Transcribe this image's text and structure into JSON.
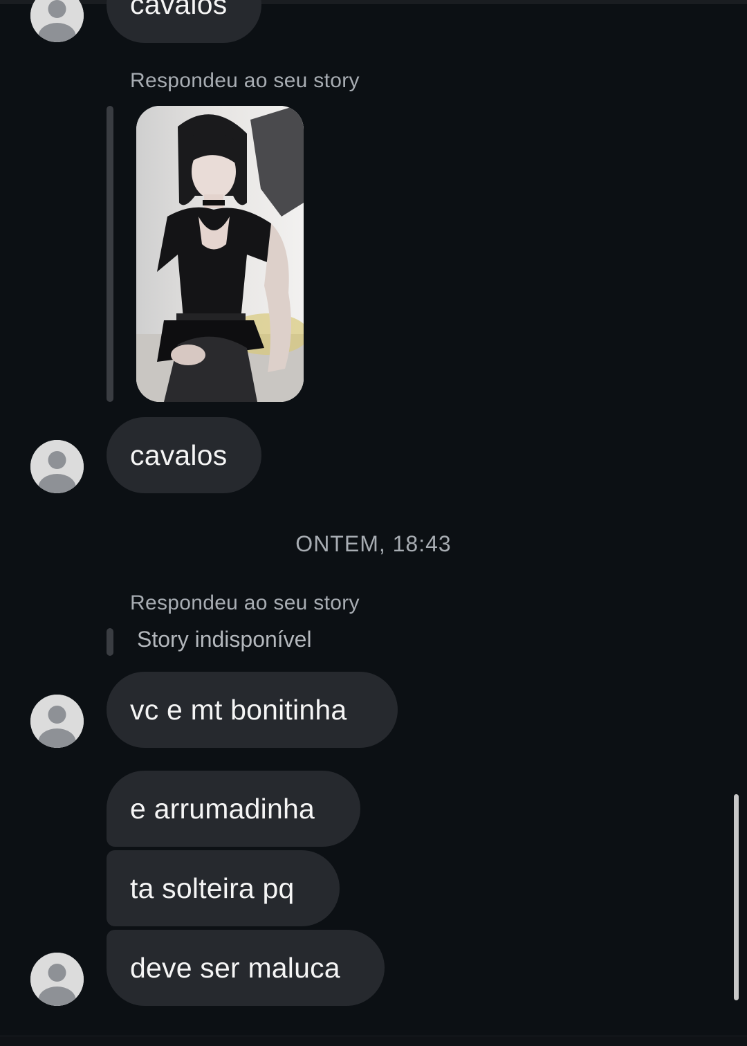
{
  "messages": {
    "top_partial": "cavalos",
    "reply_label_1": "Respondeu ao seu story",
    "story_image_icon": "story-photo",
    "msg_1": "cavalos",
    "timestamp": "ONTEM, 18:43",
    "reply_label_2": "Respondeu ao seu story",
    "story_unavailable": "Story indisponível",
    "msg_2": "vc e mt bonitinha",
    "msg_3": "e arrumadinha",
    "msg_4": "ta solteira pq",
    "msg_5": "deve ser maluca"
  },
  "avatar_icon": "default-avatar-icon",
  "colors": {
    "background": "#0c1014",
    "bubble": "#26292e",
    "secondary_text": "#a8adb3"
  }
}
